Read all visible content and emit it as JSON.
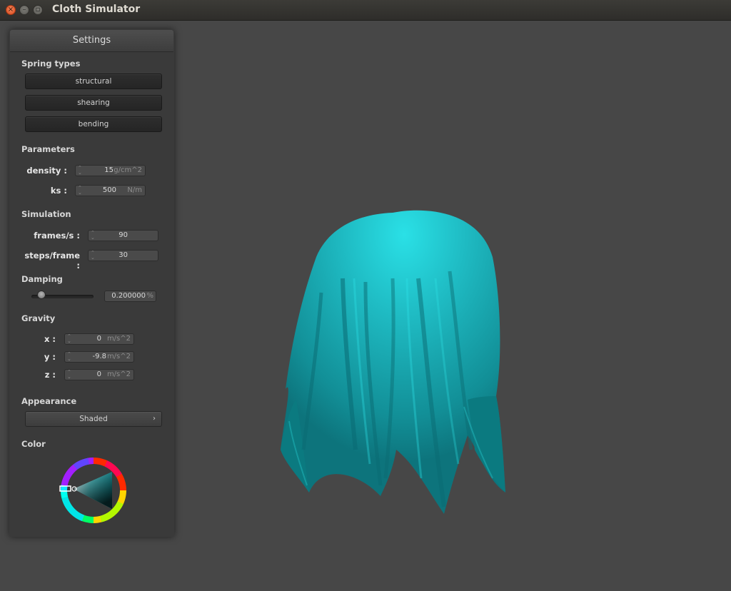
{
  "window": {
    "title": "Cloth Simulator",
    "close_glyph": "×",
    "min_glyph": "–",
    "max_glyph": "▫"
  },
  "settings": {
    "title": "Settings",
    "spring_types": {
      "heading": "Spring types",
      "buttons": [
        "structural",
        "shearing",
        "bending"
      ]
    },
    "parameters": {
      "heading": "Parameters",
      "density": {
        "label": "density :",
        "value": "15",
        "unit": "g/cm^2"
      },
      "ks": {
        "label": "ks :",
        "value": "500",
        "unit": "N/m"
      }
    },
    "simulation": {
      "heading": "Simulation",
      "frames": {
        "label": "frames/s :",
        "value": "90"
      },
      "steps": {
        "label": "steps/frame :",
        "value": "30"
      }
    },
    "damping": {
      "heading": "Damping",
      "value": "0.200000",
      "unit": "%",
      "slider_fraction": 0.2
    },
    "gravity": {
      "heading": "Gravity",
      "x": {
        "label": "x :",
        "value": "0",
        "unit": "m/s^2"
      },
      "y": {
        "label": "y :",
        "value": "-9.8",
        "unit": "m/s^2"
      },
      "z": {
        "label": "z :",
        "value": "0",
        "unit": "m/s^2"
      }
    },
    "appearance": {
      "heading": "Appearance",
      "mode": "Shaded",
      "chevron": "›"
    },
    "color": {
      "heading": "Color",
      "selected": "#1fb6bf"
    }
  },
  "viewport": {
    "background": "#474747",
    "cloth_color": "#1fb6bf"
  }
}
